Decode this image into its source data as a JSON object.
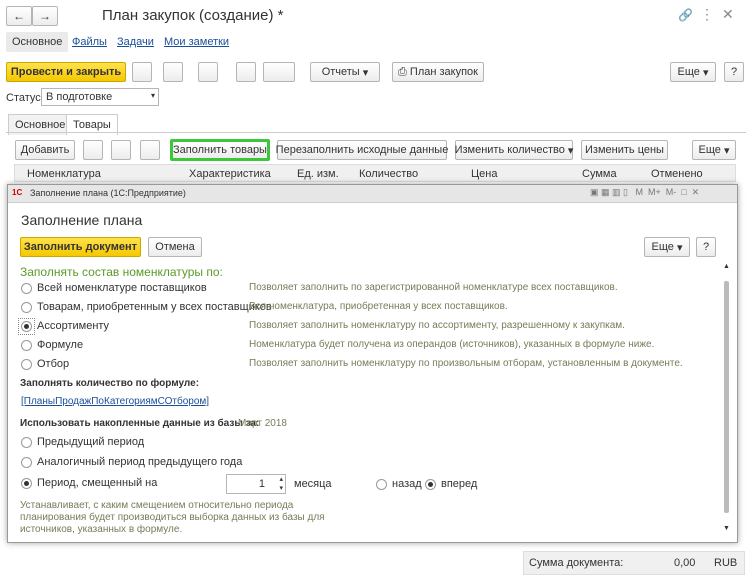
{
  "window": {
    "title": "План закупок (создание) *"
  },
  "nav": [
    "Основное",
    "Файлы",
    "Задачи",
    "Мои заметки"
  ],
  "toolbar": {
    "post_close": "Провести и закрыть",
    "reports": "Отчеты",
    "purchase_plan": "План закупок",
    "more": "Еще"
  },
  "status": {
    "label": "Статус:",
    "value": "В подготовке"
  },
  "tabs": [
    "Основное",
    "Товары"
  ],
  "goods_toolbar": {
    "add": "Добавить",
    "fill": "Заполнить товары",
    "refill": "Перезаполнить исходные данные",
    "change_qty": "Изменить количество",
    "change_price": "Изменить цены",
    "more": "Еще"
  },
  "table": {
    "columns": [
      "Номенклатура",
      "Характеристика",
      "Ед. изм.",
      "Количество",
      "Цена",
      "Сумма",
      "Отменено"
    ]
  },
  "dialog": {
    "window_title": "Заполнение плана (1С:Предприятие)",
    "title": "Заполнение плана",
    "fill_button": "Заполнить документ",
    "cancel_button": "Отмена",
    "more": "Еще",
    "help": "?",
    "section1": "Заполнять состав номенклатуры по:",
    "options": [
      {
        "label": "Всей номенклатуре поставщиков",
        "desc": "Позволяет заполнить по зарегистрированной номенклатуре всех поставщиков."
      },
      {
        "label": "Товарам, приобретенным у всех поставщиков",
        "desc": "Вся номенклатура, приобретенная у всех поставщиков."
      },
      {
        "label": "Ассортименту",
        "desc": "Позволяет заполнить номенклатуру по ассортименту, разрешенному к закупкам."
      },
      {
        "label": "Формуле",
        "desc": "Номенклатура будет получена из операндов (источников), указанных в формуле ниже."
      },
      {
        "label": "Отбор",
        "desc": "Позволяет заполнить номенклатуру по произвольным отборам, установленным в документе."
      }
    ],
    "formula_label": "Заполнять количество по формуле:",
    "formula_link": "[ПланыПродажПоКатегориямСОтбором]",
    "accum_label": "Использовать накопленные данные из базы за:",
    "accum_value": "Март 2018",
    "periods": [
      "Предыдущий период",
      "Аналогичный период предыдущего года",
      "Период, смещенный на"
    ],
    "offset_value": "1",
    "months": "месяца",
    "back": "назад",
    "forward": "вперед",
    "note": [
      "Устанавливает, с каким смещением относительно периода",
      "планирования будет производиться выборка данных из базы для",
      "источников, указанных в формуле."
    ]
  },
  "footer": {
    "sum_label": "Сумма документа:",
    "sum_value": "0,00",
    "currency": "RUB"
  }
}
